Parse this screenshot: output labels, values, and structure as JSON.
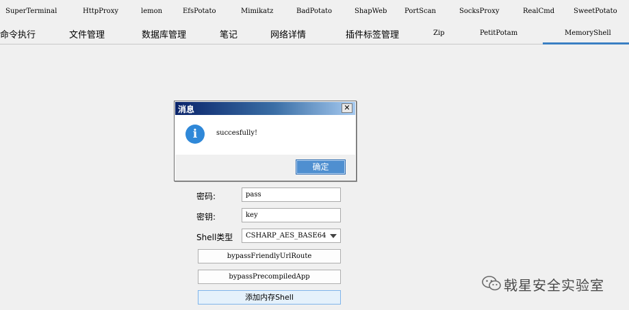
{
  "plugin_tabs": [
    "SuperTerminal",
    "HttpProxy",
    "lemon",
    "EfsPotato",
    "Mimikatz",
    "BadPotato",
    "ShapWeb",
    "PortScan",
    "SocksProxy",
    "RealCmd",
    "SweetPotato"
  ],
  "main_tabs": [
    "命令执行",
    "文件管理",
    "数据库管理",
    "笔记",
    "网络详情",
    "插件标签管理",
    "Zip",
    "PetitPotam",
    "MemoryShell"
  ],
  "active_main_tab": "MemoryShell",
  "dialog": {
    "title": "消息",
    "close_glyph": "✕",
    "icon": "info-icon",
    "icon_glyph": "i",
    "message": "succesfully!",
    "ok_label": "确定"
  },
  "form": {
    "password_label": "密码:",
    "password_value": "pass",
    "key_label": "密钥:",
    "key_value": "key",
    "shell_type_label": "Shell类型",
    "shell_type_value": "CSHARP_AES_BASE64",
    "bypass_friendly_url_label": "bypassFriendlyUrlRoute",
    "bypass_precompiled_label": "bypassPrecompiledApp",
    "add_shell_label": "添加内存Shell"
  },
  "watermark": {
    "text": "戟星安全实验室",
    "icon": "wechat-icon"
  },
  "colors": {
    "active_tab_underline": "#3a7fc3",
    "titlebar_start": "#0a246a",
    "titlebar_end": "#a6caf0",
    "info_icon": "#2f88d8",
    "ok_button": "#4f8fd0"
  }
}
